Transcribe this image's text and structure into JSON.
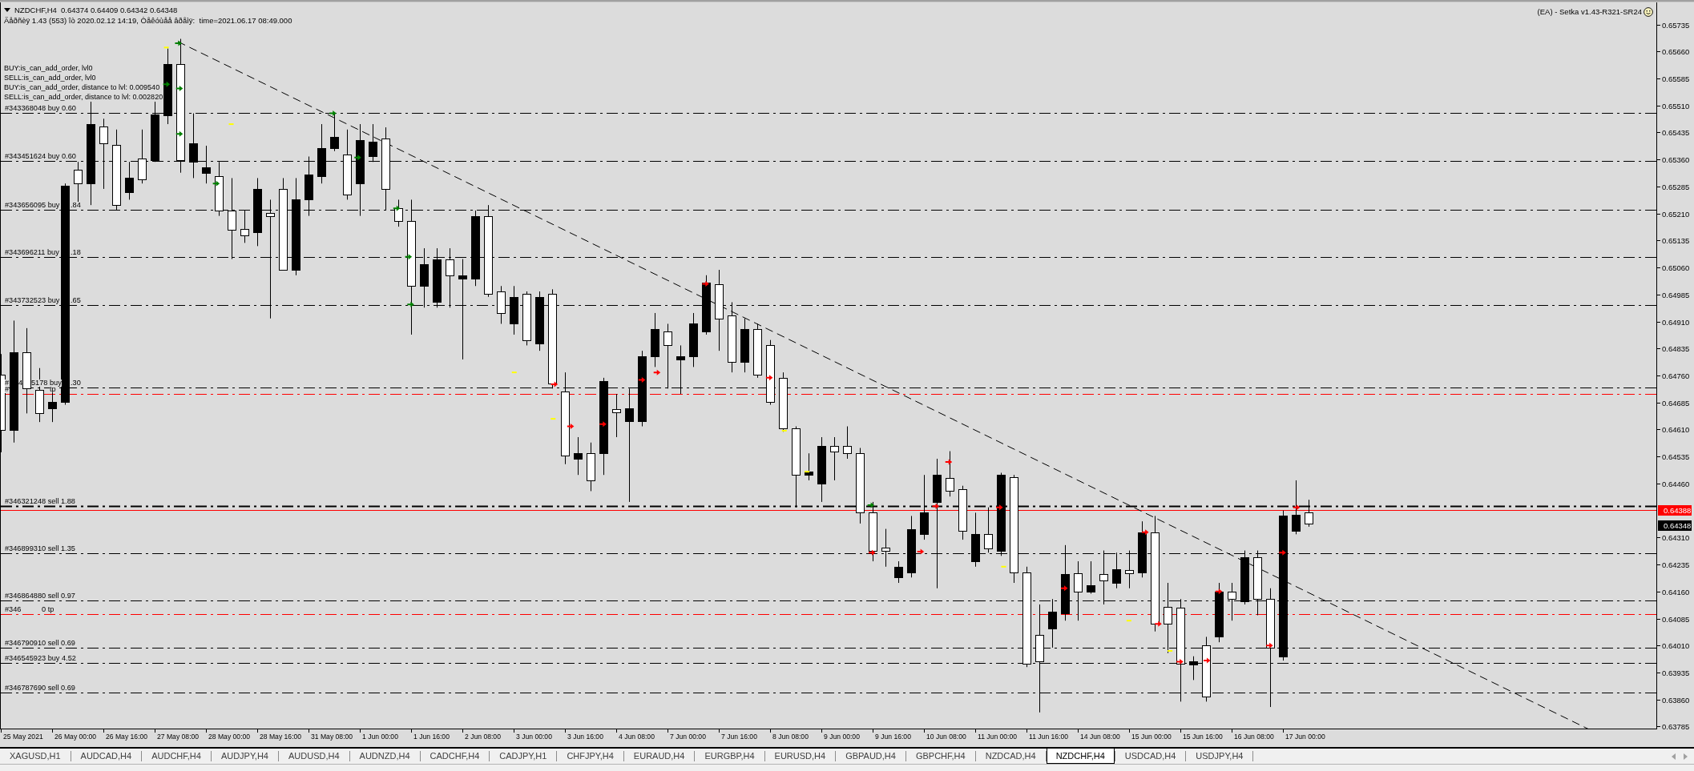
{
  "chart": {
    "header": "NZDCHF,H4  0.64374 0.64409 0.64342 0.64348",
    "info_line": "Äåðñèÿ 1.43 (553) îò 2020.02.12 14:19, Òåêóùåå âðåìÿ:  time=2021.06.17 08:49.000",
    "expert_label": "(EA) - Setka v1.43-R321-SR24",
    "status_lines": [
      "BUY:is_can_add_order, lvl0",
      "SELL:is_can_add_order, lvl0",
      "BUY:is_can_add_order, distance to lvl: 0.009540",
      "SELL:is_can_add_order, distance to lvl: 0.002820"
    ],
    "order_lines": [
      {
        "label_parts": [
          "#343368048 buy 0.60"
        ],
        "kind": "order"
      },
      {
        "label_parts": [
          "#343451624 buy 0.60"
        ],
        "kind": "order"
      },
      {
        "label_parts": [
          "#343656095 buy",
          ".84"
        ],
        "kind": "order"
      },
      {
        "label_parts": [
          "#343696211 buy",
          ".18"
        ],
        "kind": "order"
      },
      {
        "label_parts": [
          "#343732523 buy",
          ".65"
        ],
        "kind": "order"
      },
      {
        "label_parts": [
          "#",
          "4",
          "5178 buy",
          ".30"
        ],
        "kind": "order"
      },
      {
        "label_parts": [
          "#",
          "tp"
        ],
        "kind": "take_profit"
      },
      {
        "label_parts": [
          "#346321248 sell 1.88"
        ],
        "kind": "order"
      },
      {
        "label_parts": [
          "#346899310 sell 1.35"
        ],
        "kind": "order"
      },
      {
        "label_parts": [
          "#346864880 sell 0.97"
        ],
        "kind": "order"
      },
      {
        "label_parts": [
          "#346",
          "0 tp"
        ],
        "kind": "take_profit"
      },
      {
        "label_parts": [
          "#346790910 sell 0.69"
        ],
        "kind": "order"
      },
      {
        "label_parts": [
          "#346545923 buy 4.52"
        ],
        "kind": "order"
      },
      {
        "label_parts": [
          "#346787690 sell 0.69"
        ],
        "kind": "order"
      }
    ],
    "price_axis": {
      "ticks": [
        "0.65735",
        "0.65660",
        "0.65585",
        "0.65510",
        "0.65435",
        "0.65360",
        "0.65285",
        "0.65210",
        "0.65135",
        "0.65060",
        "0.64985",
        "0.64910",
        "0.64835",
        "0.64760",
        "0.64685",
        "0.64610",
        "0.64535",
        "0.64460",
        "0.64310",
        "0.64235",
        "0.64160",
        "0.64085",
        "0.64010",
        "0.63935",
        "0.63860",
        "0.63785"
      ],
      "markers": [
        {
          "text": "0.64388",
          "kind": "ask"
        },
        {
          "text": "0.64348",
          "kind": "bid"
        }
      ]
    },
    "time_axis": [
      "25 May 2021",
      "26 May 00:00",
      "26 May 16:00",
      "27 May 08:00",
      "28 May 00:00",
      "28 May 16:00",
      "31 May 08:00",
      "1 Jun 00:00",
      "1 Jun 16:00",
      "2 Jun 08:00",
      "3 Jun 00:00",
      "3 Jun 16:00",
      "4 Jun 08:00",
      "7 Jun 00:00",
      "7 Jun 16:00",
      "8 Jun 08:00",
      "9 Jun 00:00",
      "9 Jun 16:00",
      "10 Jun 08:00",
      "11 Jun 00:00",
      "11 Jun 16:00",
      "14 Jun 08:00",
      "15 Jun 00:00",
      "15 Jun 16:00",
      "16 Jun 08:00",
      "17 Jun 00:00"
    ]
  },
  "tabs": [
    {
      "label": "XAGUSD,H1",
      "selected": false
    },
    {
      "label": "AUDCAD,H4",
      "selected": false
    },
    {
      "label": "AUDCHF,H4",
      "selected": false
    },
    {
      "label": "AUDJPY,H4",
      "selected": false
    },
    {
      "label": "AUDUSD,H4",
      "selected": false
    },
    {
      "label": "AUDNZD,H4",
      "selected": false
    },
    {
      "label": "CADCHF,H4",
      "selected": false
    },
    {
      "label": "CADJPY,H1",
      "selected": false
    },
    {
      "label": "CHFJPY,H4",
      "selected": false
    },
    {
      "label": "EURAUD,H4",
      "selected": false
    },
    {
      "label": "EURGBP,H4",
      "selected": false
    },
    {
      "label": "EURUSD,H4",
      "selected": false
    },
    {
      "label": "GBPAUD,H4",
      "selected": false
    },
    {
      "label": "GBPCHF,H4",
      "selected": false
    },
    {
      "label": "NZDCAD,H4",
      "selected": false
    },
    {
      "label": "NZDCHF,H4",
      "selected": true
    },
    {
      "label": "USDCAD,H4",
      "selected": false
    },
    {
      "label": "USDJPY,H4",
      "selected": false
    }
  ]
}
